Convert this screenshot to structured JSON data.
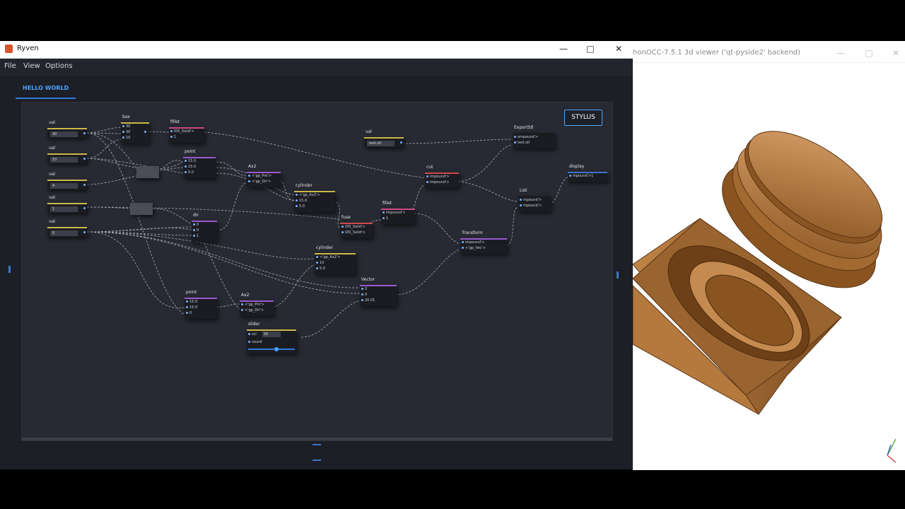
{
  "ryven": {
    "title": "Ryven",
    "menu": [
      "File",
      "View",
      "Options"
    ],
    "tab": "HELLO WORLD",
    "stylus_label": "STYLUS"
  },
  "nodes": {
    "val1": {
      "title": "val",
      "value": "30"
    },
    "val2": {
      "title": "val",
      "value": "10"
    },
    "val3": {
      "title": "val",
      "value": "4"
    },
    "val4": {
      "title": "val",
      "value": "1"
    },
    "val5": {
      "title": "val",
      "value": "0"
    },
    "box": {
      "title": "box",
      "ports": [
        "30",
        "30",
        "10"
      ]
    },
    "fillet1": {
      "title": "fillet",
      "ports": [
        "iDS_Solid'>",
        "1"
      ]
    },
    "point1": {
      "title": "point",
      "ports": [
        "15.0",
        "15.0",
        "5.0"
      ]
    },
    "ax2_1": {
      "title": "Ax2",
      "ports": [
        "<'gp_Pnt'>",
        "<'gp_Dir'>"
      ]
    },
    "cylinder1": {
      "title": "cylinder",
      "ports": [
        "<'gp_Ax2'>",
        "15.0",
        "5.0"
      ]
    },
    "dir": {
      "title": "dir",
      "ports": [
        "0",
        "0",
        "1"
      ]
    },
    "fuse": {
      "title": "fuse",
      "ports": [
        "iDS_Solid'>",
        "iDS_Solid'>"
      ]
    },
    "fillet2": {
      "title": "fillet",
      "ports": [
        "impound'>",
        "1"
      ]
    },
    "cut": {
      "title": "cut",
      "ports": [
        "impound'>",
        "impound'>"
      ]
    },
    "val6": {
      "title": "val",
      "value": "test.stl"
    },
    "exportstl": {
      "title": "ExportStl",
      "ports": [
        "ompound'>",
        "test.stl"
      ]
    },
    "display": {
      "title": "display",
      "ports": [
        "mpound'>1"
      ]
    },
    "list": {
      "title": "List",
      "ports": [
        "mpound'>",
        "mpound'>"
      ]
    },
    "transform": {
      "title": "Transform",
      "ports": [
        "impound'>",
        "<'gp_Vec'>"
      ]
    },
    "cylinder2": {
      "title": "cylinder",
      "ports": [
        "<'gp_Ax2'>",
        "10",
        "5.0"
      ]
    },
    "vector": {
      "title": "Vector",
      "ports": [
        "0",
        "0",
        "20.01"
      ]
    },
    "point2": {
      "title": "point",
      "ports": [
        "15.0",
        "15.0",
        "0"
      ]
    },
    "ax2_2": {
      "title": "Ax2",
      "ports": [
        "<'gp_Pnt'>",
        "<'gp_Dir'>"
      ]
    },
    "slider": {
      "title": "slider",
      "ports": [
        "scl",
        "round"
      ],
      "value": "50",
      "level": 0.6
    }
  },
  "occ": {
    "title": "honOCC-7.5.1 3d viewer ('qt-pyside2' backend)"
  },
  "colors": {
    "canvas_bg": "#272a33",
    "accent_blue": "#4aa3ff",
    "model_brown": "#a0682a"
  }
}
